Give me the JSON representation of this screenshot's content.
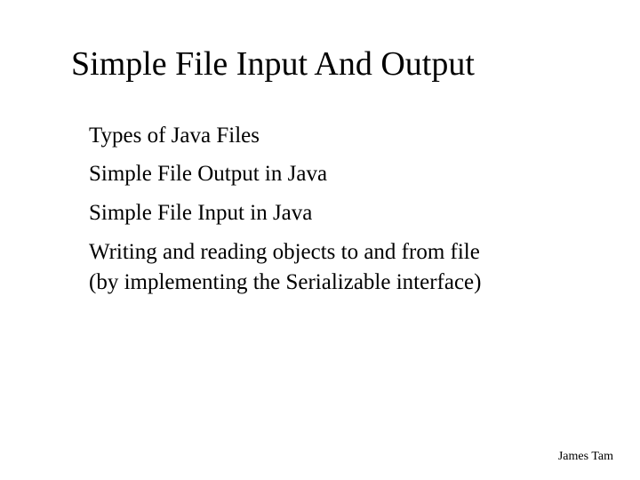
{
  "slide": {
    "title": "Simple File Input And Output",
    "items": [
      "Types of Java Files",
      "Simple File Output in Java",
      "Simple File Input in Java",
      "Writing and reading objects to and from file (by implementing the Serializable interface)"
    ],
    "footer": "James Tam"
  }
}
